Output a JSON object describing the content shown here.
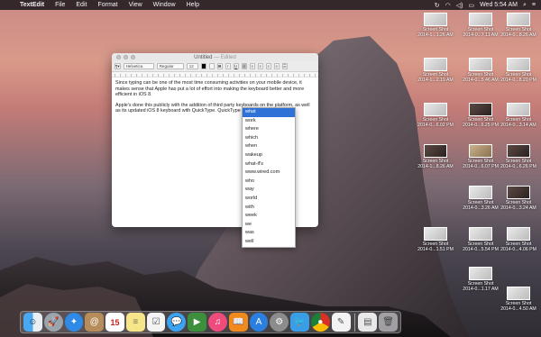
{
  "menubar": {
    "app_name": "TextEdit",
    "menus": [
      "File",
      "Edit",
      "Format",
      "View",
      "Window",
      "Help"
    ],
    "clock": "Wed 5:54 AM"
  },
  "window": {
    "title": "Untitled",
    "title_state": "— Edited",
    "font_family_value": "Helvetica",
    "font_style_value": "Regular",
    "font_size_value": "12",
    "paragraph_1": "Since typing can be one of the most time consuming activities on your mobile device, it makes sense that Apple has put a lot of effort into making the keyboard better and more efficient in iOS 8.",
    "paragraph_2": "Apple's done this publicly with the addition of third party keyboards on the platform, as well as its updated iOS 8 keyboard with QuickType. QuickType learns from what"
  },
  "autocomplete": {
    "items": [
      "what",
      "work",
      "where",
      "which",
      "when",
      "wakeup",
      "what-if's",
      "www.wired.com",
      "who",
      "way",
      "world",
      "with",
      "week",
      "we",
      "was",
      "well"
    ],
    "selected_index": 0
  },
  "desktop": {
    "icons": [
      {
        "line1": "Screen Shot",
        "line2": "2014-1...1.26 AM"
      },
      {
        "line1": "Screen Shot",
        "line2": "2014-0...7.11 AM"
      },
      {
        "line1": "Screen Shot",
        "line2": "2014-0...8.26 AM"
      },
      {
        "line1": "Screen Shot",
        "line2": "2014-1...2.19 AM"
      },
      {
        "line1": "Screen Shot",
        "line2": "2014-0...5.46 AM"
      },
      {
        "line1": "Screen Shot",
        "line2": "2014-0...8.20 PM"
      },
      {
        "line1": "Screen Shot",
        "line2": "2014-0...6.02 PM"
      },
      {
        "line1": "Screen Shot",
        "line2": "2014-0...6.25 PM"
      },
      {
        "line1": "Screen Shot",
        "line2": "2014-0...3.14 AM"
      },
      {
        "line1": "Screen Shot",
        "line2": "2014-1...8.26 AM"
      },
      {
        "line1": "Screen Shot",
        "line2": "2014-0...6.07 PM"
      },
      {
        "line1": "Screen Shot",
        "line2": "2014-0...6.26 PM"
      },
      {
        "line1": "Screen Shot",
        "line2": "2014-0...3.26 AM"
      },
      {
        "line1": "Screen Shot",
        "line2": "2014-0...3.24 AM"
      },
      {
        "line1": "Screen Shot",
        "line2": "2014-0...1.51 PM"
      },
      {
        "line1": "Screen Shot",
        "line2": "2014-0...5.54 PM"
      },
      {
        "line1": "Screen Shot",
        "line2": "2014-0...4.06 PM"
      },
      {
        "line1": "Screen Shot",
        "line2": "2014-0...1.17 AM"
      },
      {
        "line1": "Screen Shot",
        "line2": "2014-0...4.50 AM"
      }
    ]
  },
  "dock": {
    "icons": [
      "finder-icon",
      "launchpad-icon",
      "safari-icon",
      "contacts-icon",
      "calendar-icon",
      "notes-icon",
      "reminders-icon",
      "messages-icon",
      "facetime-icon",
      "itunes-icon",
      "ibooks-icon",
      "appstore-icon",
      "system-preferences-icon",
      "twitter-icon",
      "chrome-icon",
      "textedit-icon",
      "documents-icon",
      "trash-icon"
    ],
    "calendar_day": "15"
  },
  "colors": {
    "selection": "#2f72d7"
  }
}
